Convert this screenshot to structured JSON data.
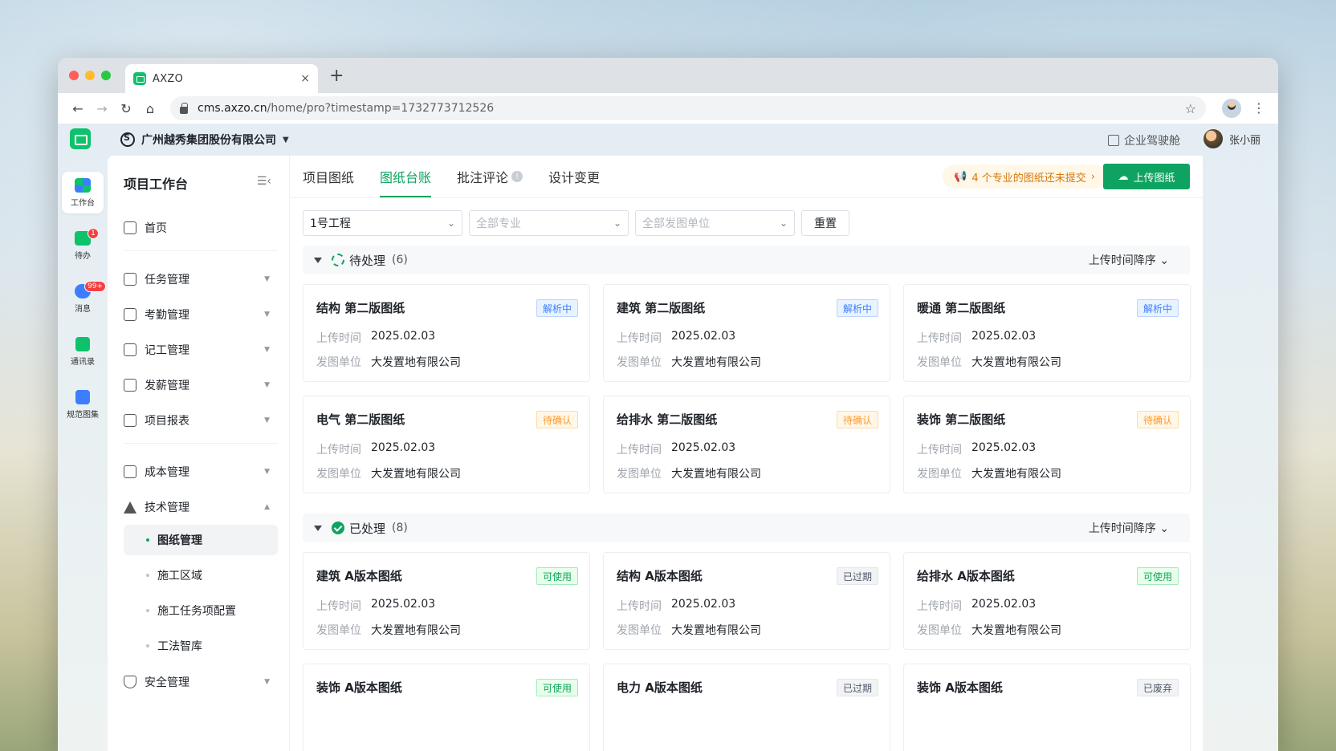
{
  "browser": {
    "tab_title": "AXZO",
    "new_tab": "+",
    "close": "×",
    "url_host": "cms.axzo.cn",
    "url_path": "/home/pro?timestamp=1732773712526"
  },
  "header": {
    "org_name": "广州越秀集团股份有限公司",
    "cockpit": "企业驾驶舱",
    "user_name": "张小丽"
  },
  "rail": [
    {
      "label": "工作台",
      "icon": "workbench-icon",
      "badge": ""
    },
    {
      "label": "待办",
      "icon": "todo-icon",
      "badge": "1"
    },
    {
      "label": "消息",
      "icon": "message-icon",
      "badge": "99+"
    },
    {
      "label": "通讯录",
      "icon": "contacts-icon",
      "badge": ""
    },
    {
      "label": "规范图集",
      "icon": "standards-icon",
      "badge": ""
    }
  ],
  "sidebar": {
    "title": "项目工作台",
    "items": {
      "home": "首页",
      "task": "任务管理",
      "attendance": "考勤管理",
      "worklog": "记工管理",
      "salary": "发薪管理",
      "report": "项目报表",
      "cost": "成本管理",
      "tech": "技术管理",
      "drawings": "图纸管理",
      "area": "施工区域",
      "taskconf": "施工任务项配置",
      "methods": "工法智库",
      "safety": "安全管理"
    }
  },
  "main": {
    "tabs": [
      "项目图纸",
      "图纸台账",
      "批注评论",
      "设计变更"
    ],
    "active_tab": "图纸台账",
    "notice": "4 个专业的图纸还未提交",
    "upload_button": "上传图纸",
    "filters": {
      "project": "1号工程",
      "discipline_placeholder": "全部专业",
      "issuer_placeholder": "全部发图单位",
      "reset": "重置"
    },
    "sort_label": "上传时间降序",
    "field_upload_time": "上传时间",
    "field_issuer": "发图单位"
  },
  "groups": [
    {
      "title": "待处理",
      "count": "(6)",
      "cards": [
        {
          "title": "结构 第二版图纸",
          "status": "解析中",
          "upload_time": "2025.02.03",
          "issuer": "大发置地有限公司"
        },
        {
          "title": "建筑 第二版图纸",
          "status": "解析中",
          "upload_time": "2025.02.03",
          "issuer": "大发置地有限公司"
        },
        {
          "title": "暖通 第二版图纸",
          "status": "解析中",
          "upload_time": "2025.02.03",
          "issuer": "大发置地有限公司"
        },
        {
          "title": "电气 第二版图纸",
          "status": "待确认",
          "upload_time": "2025.02.03",
          "issuer": "大发置地有限公司"
        },
        {
          "title": "给排水 第二版图纸",
          "status": "待确认",
          "upload_time": "2025.02.03",
          "issuer": "大发置地有限公司"
        },
        {
          "title": "装饰 第二版图纸",
          "status": "待确认",
          "upload_time": "2025.02.03",
          "issuer": "大发置地有限公司"
        }
      ]
    },
    {
      "title": "已处理",
      "count": "(8)",
      "cards": [
        {
          "title": "建筑 A版本图纸",
          "status": "可使用",
          "upload_time": "2025.02.03",
          "issuer": "大发置地有限公司"
        },
        {
          "title": "结构 A版本图纸",
          "status": "已过期",
          "upload_time": "2025.02.03",
          "issuer": "大发置地有限公司"
        },
        {
          "title": "给排水 A版本图纸",
          "status": "可使用",
          "upload_time": "2025.02.03",
          "issuer": "大发置地有限公司"
        },
        {
          "title": "装饰 A版本图纸",
          "status": "可使用"
        },
        {
          "title": "电力 A版本图纸",
          "status": "已过期"
        },
        {
          "title": "装饰 A版本图纸",
          "status": "已废弃"
        }
      ]
    }
  ]
}
